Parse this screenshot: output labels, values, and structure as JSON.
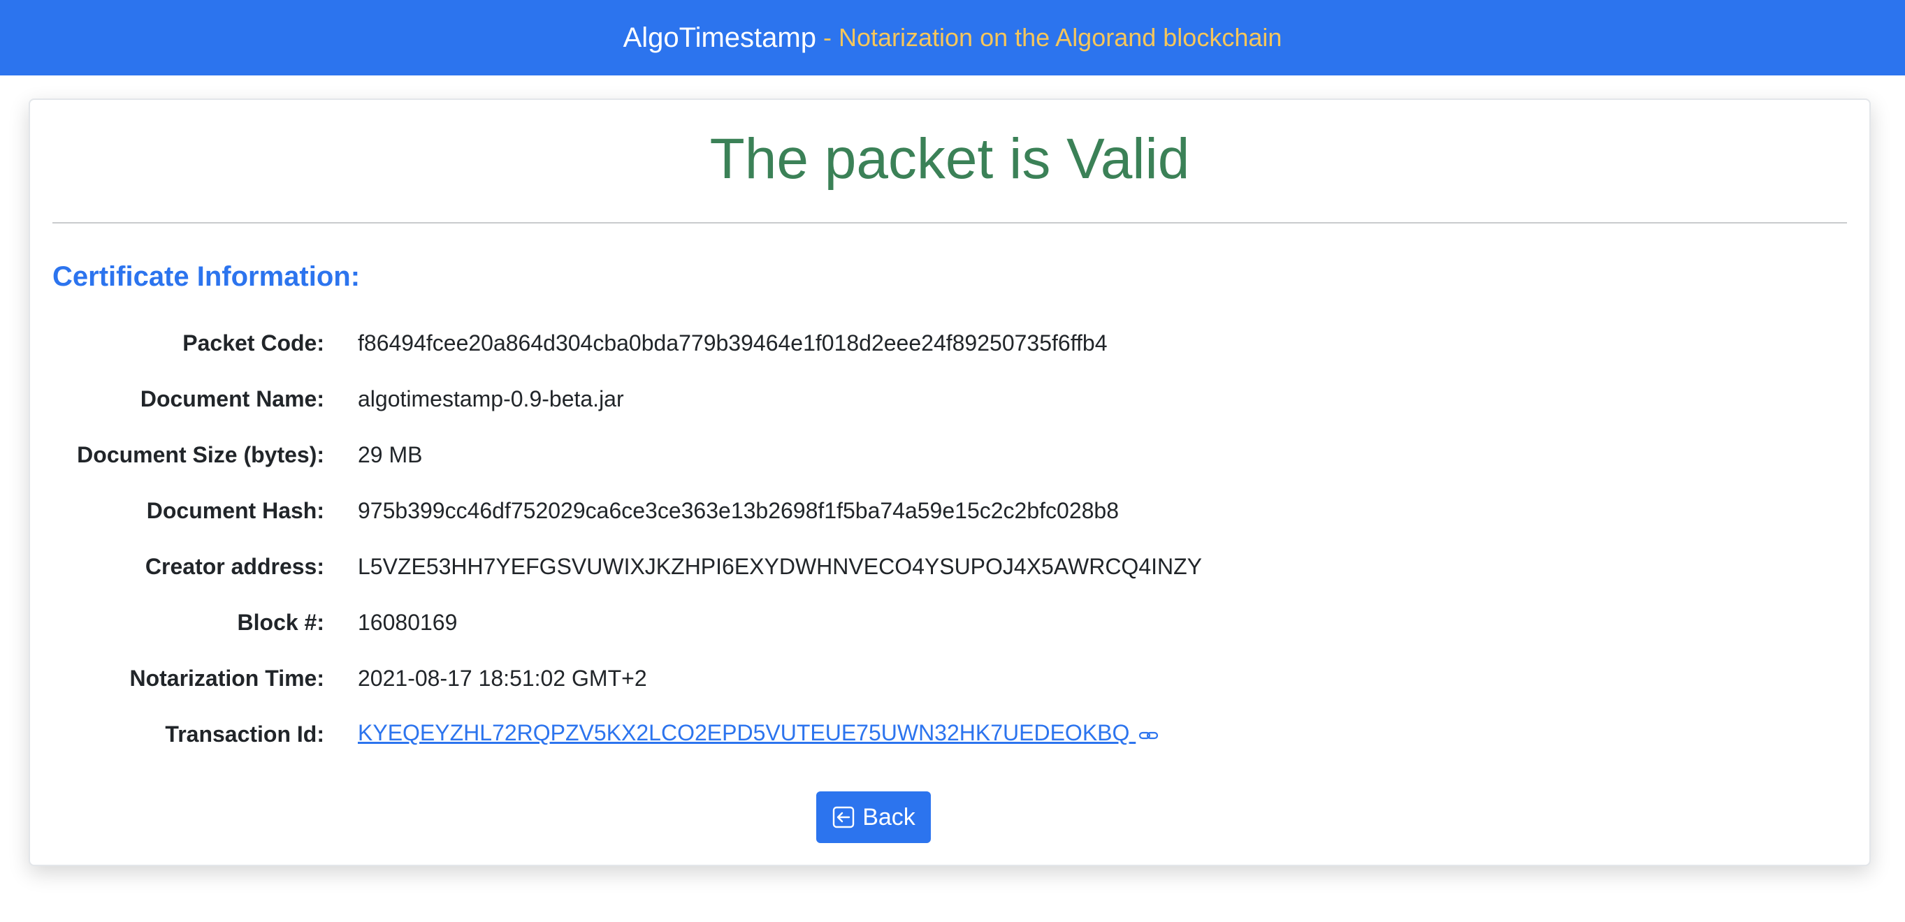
{
  "header": {
    "brand": "AlgoTimestamp",
    "tagline": "- Notarization on the Algorand blockchain"
  },
  "result": {
    "title": "The packet is Valid",
    "section_title": "Certificate Information:"
  },
  "certificate": {
    "fields": [
      {
        "label": "Packet Code:",
        "value": "f86494fcee20a864d304cba0bda779b39464e1f018d2eee24f89250735f6ffb4"
      },
      {
        "label": "Document Name:",
        "value": "algotimestamp-0.9-beta.jar"
      },
      {
        "label": "Document Size (bytes):",
        "value": "29 MB"
      },
      {
        "label": "Document Hash:",
        "value": "975b399cc46df752029ca6ce3ce363e13b2698f1f5ba74a59e15c2c2bfc028b8"
      },
      {
        "label": "Creator address:",
        "value": "L5VZE53HH7YEFGSVUWIXJKZHPI6EXYDWHNVECO4YSUPOJ4X5AWRCQ4INZY"
      },
      {
        "label": "Block #:",
        "value": "16080169"
      },
      {
        "label": "Notarization Time:",
        "value": "2021-08-17 18:51:02 GMT+2"
      },
      {
        "label": "Transaction Id:",
        "value": "KYEQEYZHL72RQPZV5KX2LCO2EPD5VUTEUE75UWN32HK7UEDEOKBQ"
      }
    ]
  },
  "actions": {
    "back_label": "Back"
  },
  "colors": {
    "header_bg": "#2c74ee",
    "tagline": "#f6c65b",
    "valid_green": "#3b8157",
    "link_blue": "#2c74ee"
  },
  "icons": {
    "transaction_link": "link-icon",
    "back": "arrow-left-square-icon"
  }
}
